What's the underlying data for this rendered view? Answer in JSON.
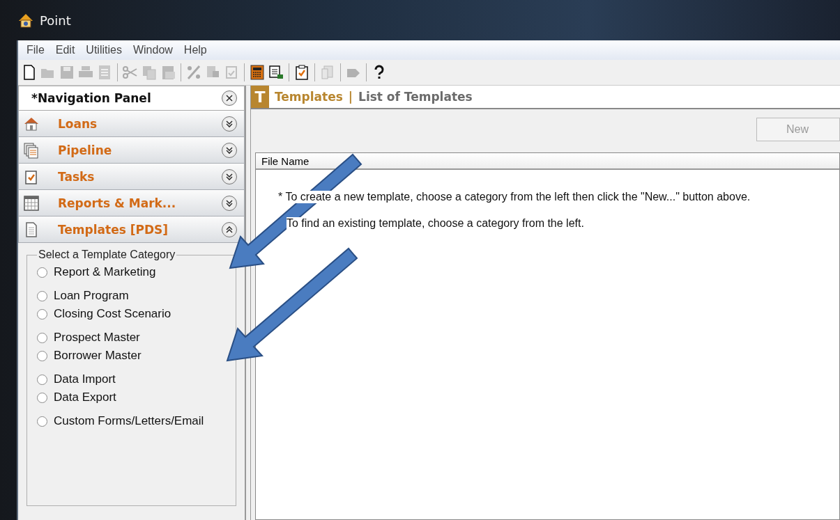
{
  "window": {
    "title": "Point"
  },
  "menu": [
    {
      "label": "File"
    },
    {
      "label": "Edit"
    },
    {
      "label": "Utilities"
    },
    {
      "label": "Window"
    },
    {
      "label": "Help"
    }
  ],
  "toolbar": [
    {
      "kind": "new",
      "disabled": false
    },
    {
      "kind": "open",
      "disabled": true
    },
    {
      "kind": "save",
      "disabled": true
    },
    {
      "kind": "print",
      "disabled": true
    },
    {
      "kind": "preview",
      "disabled": true
    },
    {
      "kind": "separator"
    },
    {
      "kind": "cut",
      "disabled": true
    },
    {
      "kind": "copy",
      "disabled": true
    },
    {
      "kind": "paste",
      "disabled": true
    },
    {
      "kind": "separator"
    },
    {
      "kind": "percent",
      "disabled": true
    },
    {
      "kind": "stamp",
      "disabled": true
    },
    {
      "kind": "check",
      "disabled": true
    },
    {
      "kind": "separator"
    },
    {
      "kind": "calculator",
      "disabled": false
    },
    {
      "kind": "report",
      "disabled": false
    },
    {
      "kind": "separator"
    },
    {
      "kind": "tasks",
      "disabled": false
    },
    {
      "kind": "separator"
    },
    {
      "kind": "doc",
      "disabled": true
    },
    {
      "kind": "separator"
    },
    {
      "kind": "tag",
      "disabled": true
    },
    {
      "kind": "separator"
    },
    {
      "kind": "help",
      "disabled": false
    }
  ],
  "navigation": {
    "title": "*Navigation Panel",
    "items": [
      {
        "kind": "loans",
        "label": "Loans",
        "expanded": false
      },
      {
        "kind": "pipeline",
        "label": "Pipeline",
        "expanded": false
      },
      {
        "kind": "tasks",
        "label": "Tasks",
        "expanded": false
      },
      {
        "kind": "reports",
        "label": "Reports & Mark...",
        "expanded": false
      },
      {
        "kind": "templates",
        "label": "Templates [PDS]",
        "expanded": true
      }
    ]
  },
  "category_box": {
    "legend": "Select a Template Category",
    "groups": [
      {
        "options": [
          {
            "label": "Report & Marketing",
            "selected": false
          }
        ]
      },
      {
        "options": [
          {
            "label": "Loan Program",
            "selected": false
          },
          {
            "label": "Closing Cost Scenario",
            "selected": false
          }
        ]
      },
      {
        "options": [
          {
            "label": "Prospect Master",
            "selected": false
          },
          {
            "label": "Borrower Master",
            "selected": false
          }
        ]
      },
      {
        "options": [
          {
            "label": "Data Import",
            "selected": false
          },
          {
            "label": "Data Export",
            "selected": false
          }
        ]
      },
      {
        "options": [
          {
            "label": "Custom Forms/Letters/Email",
            "selected": false
          }
        ]
      }
    ]
  },
  "main": {
    "badge": "T",
    "title": "Templates",
    "subtitle": "List of Templates",
    "separator": "|",
    "new_button": {
      "label": "New",
      "disabled": true
    },
    "table": {
      "columns": [
        "File Name"
      ]
    },
    "messages": [
      "* To create a new template, choose a category from the left then click the \"New...\" button above.",
      "To find an existing template, choose a category from the left."
    ]
  }
}
